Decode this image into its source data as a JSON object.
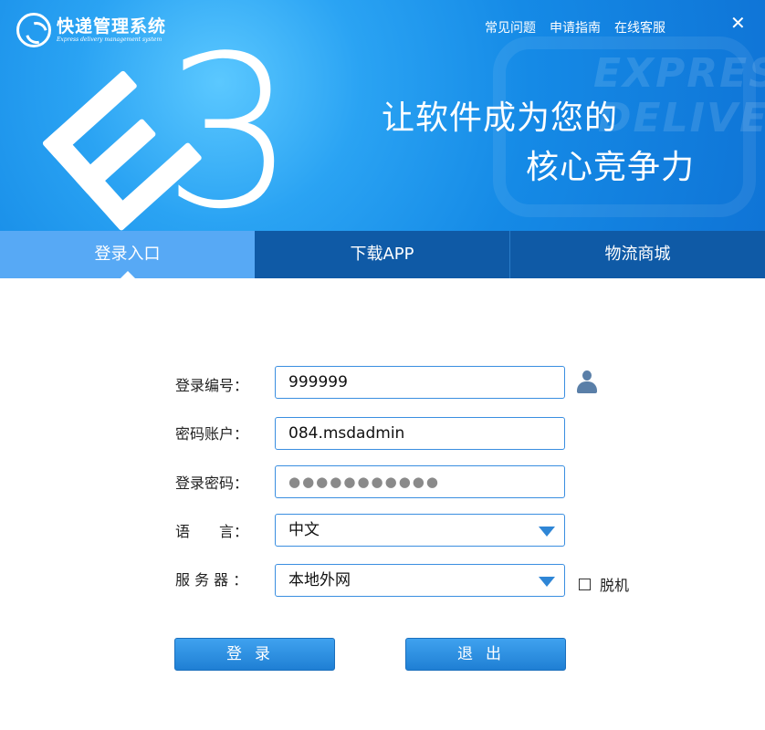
{
  "header": {
    "logo_title": "快递管理系统",
    "logo_subtitle": "Express delivery management system",
    "nav": [
      "常见问题",
      "申请指南",
      "在线客服"
    ],
    "close_symbol": "✕",
    "brand_digit": "3",
    "slogan_line1": "让软件成为您的",
    "slogan_line2": "核心竞争力",
    "watermark_1": "EXPRESS",
    "watermark_2": "DELIVER"
  },
  "tabs": [
    {
      "label": "登录入口",
      "active": true
    },
    {
      "label": "下载APP",
      "active": false
    },
    {
      "label": "物流商城",
      "active": false
    }
  ],
  "form": {
    "login_id_label": "登录编号：",
    "login_id_value": "999999",
    "account_label": "密码账户：",
    "account_value": "084.msdadmin",
    "password_label": "登录密码：",
    "password_mask": "●●●●●●●●●●●",
    "language_label": "语　　言：",
    "language_value": "中文",
    "server_label": "服 务 器 ：",
    "server_value": "本地外网",
    "offline_label": "脱机",
    "offline_checked": false
  },
  "buttons": {
    "login": "登录",
    "exit": "退出"
  },
  "colors": {
    "banner": "#158ae6",
    "tab_bar": "#0f5aa6",
    "tab_active": "#57a9f5",
    "button": "#2b8fe0",
    "field_border": "#3a8ee0"
  },
  "icons": {
    "logo": "s-swirl-logo-icon",
    "user": "user-icon",
    "dropdown": "triangle-down-icon",
    "close": "close-icon"
  }
}
